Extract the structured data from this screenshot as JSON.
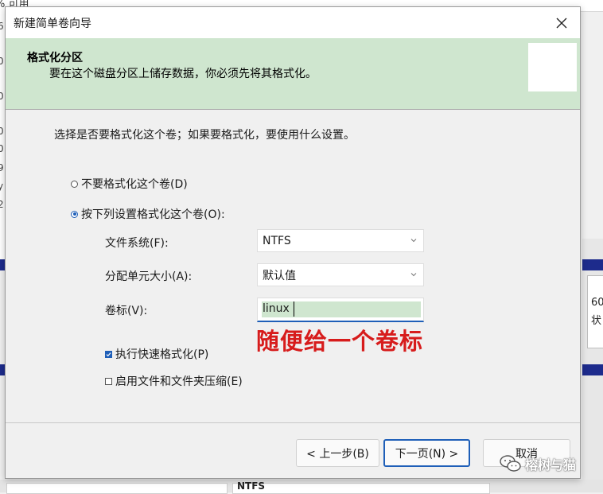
{
  "background": {
    "top_text": "% 可用",
    "left_fragments": [
      "6",
      "0",
      "0",
      "0",
      "0",
      "9",
      "y",
      "2"
    ],
    "right_text_1": "60",
    "right_text_2": "状",
    "bottom_text": "NTFS"
  },
  "wizard": {
    "title": "新建简单卷向导",
    "header": {
      "title": "格式化分区",
      "subtitle": "要在这个磁盘分区上储存数据，你必须先将其格式化。"
    },
    "intro": "选择是否要格式化这个卷；如果要格式化，要使用什么设置。",
    "options": {
      "no_format": "不要格式化这个卷(D)",
      "format": "按下列设置格式化这个卷(O):",
      "selected": "format"
    },
    "fields": {
      "fs_label": "文件系统(F):",
      "fs_value": "NTFS",
      "alloc_label": "分配单元大小(A):",
      "alloc_value": "默认值",
      "vol_label": "卷标(V):",
      "vol_value": "linux"
    },
    "annotation": "随便给一个卷标",
    "checkboxes": {
      "quick_format": {
        "label": "执行快速格式化(P)",
        "checked": true
      },
      "compression": {
        "label": "启用文件和文件夹压缩(E)",
        "checked": false
      }
    },
    "buttons": {
      "back": "< 上一步(B)",
      "next": "下一页(N) >",
      "cancel": "取消"
    }
  },
  "watermark": {
    "text": "榕树与猫"
  },
  "colors": {
    "header_bg": "#cfe6cf",
    "accent": "#1f5fb8",
    "annotation": "#d71c1c",
    "bg_bar": "#1d2b8c"
  }
}
